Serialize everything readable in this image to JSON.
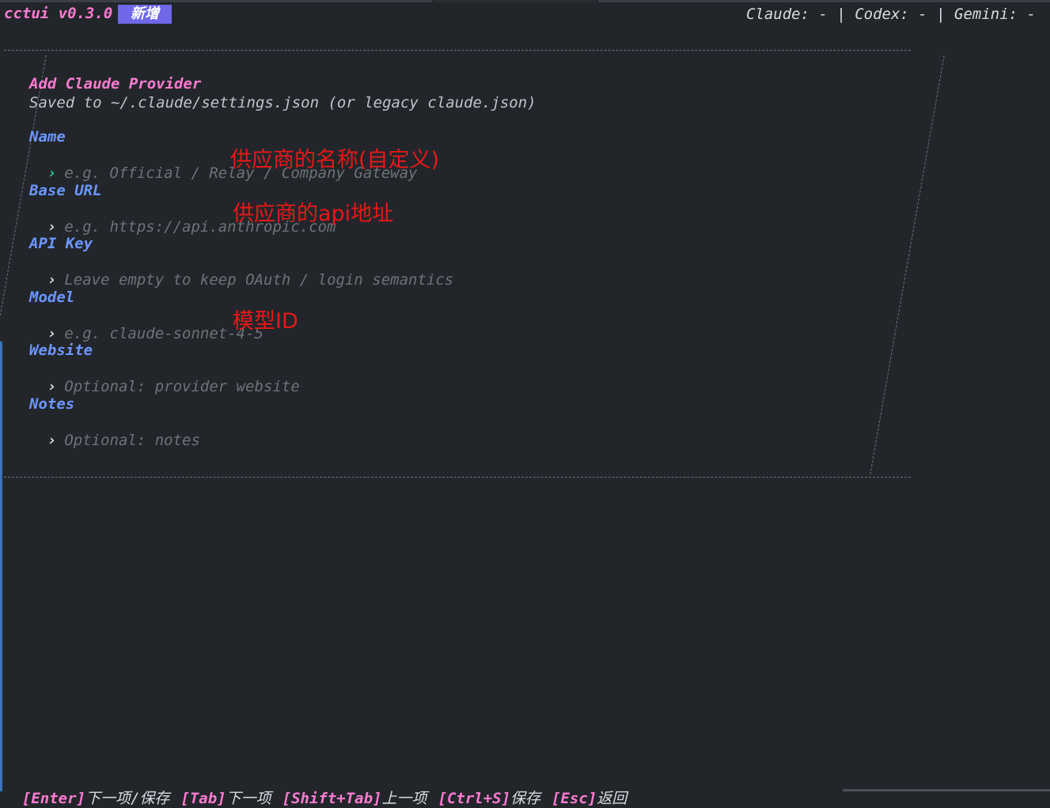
{
  "header": {
    "app_name": "cctui v0.3.0",
    "mode_badge": "新增",
    "status": "Claude: - | Codex: - | Gemini: -"
  },
  "form": {
    "title": "Add Claude Provider",
    "subtitle": "Saved to ~/.claude/settings.json (or legacy claude.json)",
    "prompt_symbol": "›",
    "fields": [
      {
        "label": "Name",
        "placeholder": "e.g. Official / Relay / Company Gateway"
      },
      {
        "label": "Base URL",
        "placeholder": "e.g. https://api.anthropic.com"
      },
      {
        "label": "API Key",
        "placeholder": "Leave empty to keep OAuth / login semantics"
      },
      {
        "label": "Model",
        "placeholder": "e.g. claude-sonnet-4-5"
      },
      {
        "label": "Website",
        "placeholder": "Optional: provider website"
      },
      {
        "label": "Notes",
        "placeholder": "Optional: notes"
      }
    ]
  },
  "annotations": {
    "name": "供应商的名称(自定义)",
    "base_url": "供应商的api地址",
    "model": "模型ID"
  },
  "footer": {
    "hints": [
      {
        "key": "[Enter]",
        "desc": "下一项/保存"
      },
      {
        "key": "[Tab]",
        "desc": "下一项"
      },
      {
        "key": "[Shift+Tab]",
        "desc": "上一项"
      },
      {
        "key": "[Ctrl+S]",
        "desc": "保存"
      },
      {
        "key": "[Esc]",
        "desc": "返回"
      }
    ]
  },
  "colors": {
    "background": "#22262b",
    "accent_pink": "#ff7bd1",
    "label_blue": "#6c96ff",
    "badge_purple": "#6f68e8",
    "annotation_red": "#e81818",
    "prompt_active_green": "#2fc18f"
  }
}
